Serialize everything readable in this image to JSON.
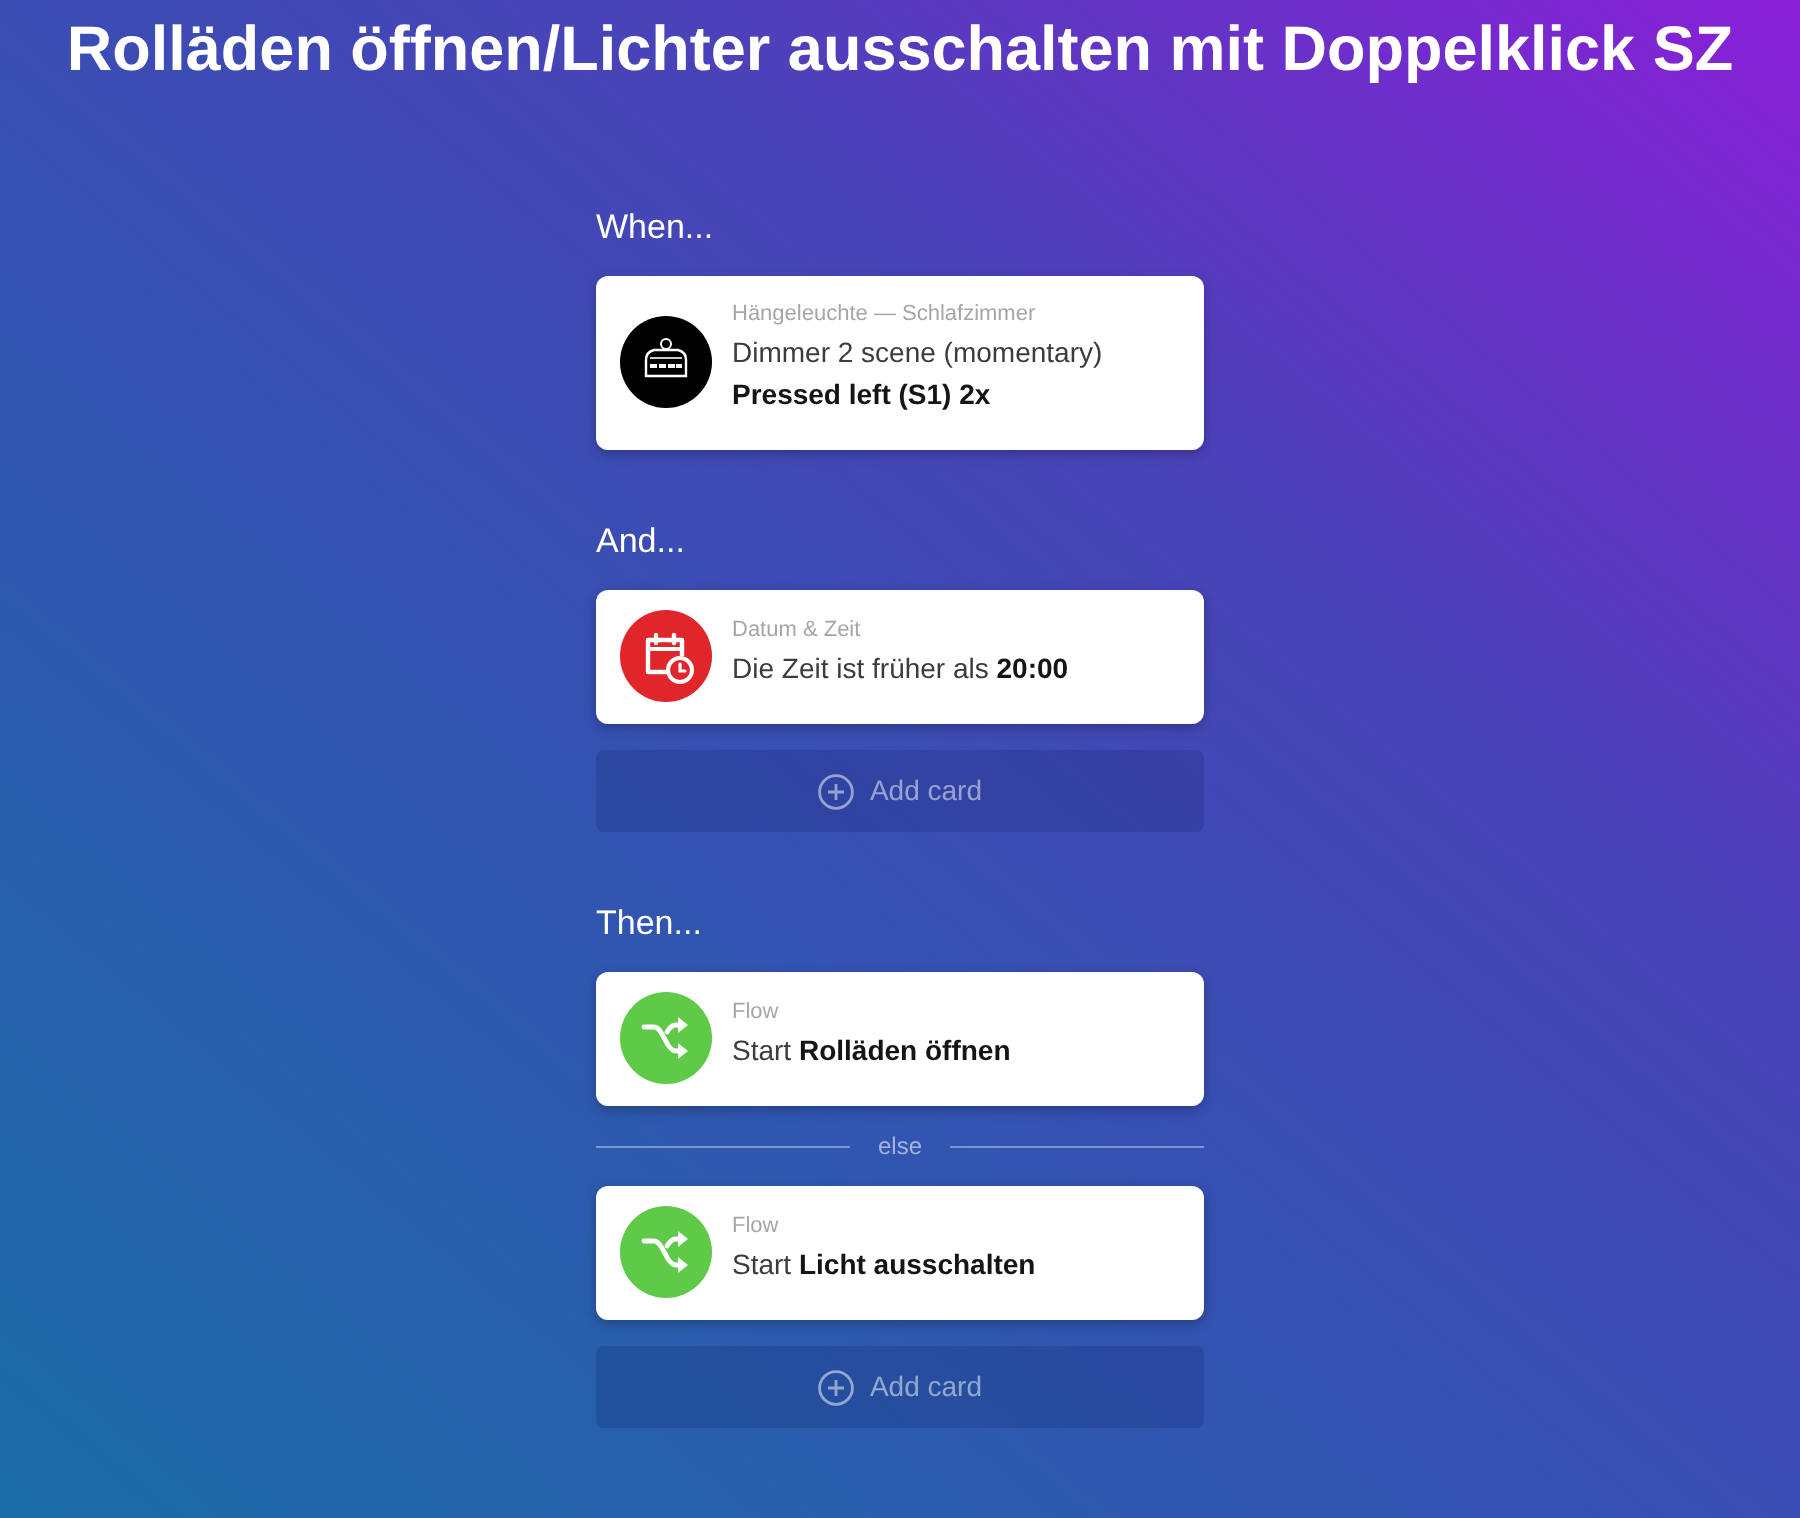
{
  "title": "Rolläden öffnen/Lichter ausschalten mit Doppelklick SZ",
  "sections": [
    {
      "heading": "When...",
      "items": [
        {
          "kind": "device",
          "source": "Hängeleuchte — Schlafzimmer",
          "text": "Dimmer 2 scene (momentary)",
          "detail": "Pressed left (S1) 2x"
        }
      ]
    },
    {
      "heading": "And...",
      "items": [
        {
          "kind": "datetime",
          "source": "Datum & Zeit",
          "text": "Die Zeit ist früher als **20:00**"
        },
        {
          "kind": "add",
          "label": "Add card"
        }
      ]
    },
    {
      "heading": "Then...",
      "items": [
        {
          "kind": "flow",
          "source": "Flow",
          "text": "Start **Rolläden öffnen**"
        },
        {
          "kind": "divider",
          "label": "else"
        },
        {
          "kind": "flow",
          "source": "Flow",
          "text": "Start **Licht ausschalten**"
        },
        {
          "kind": "add",
          "label": "Add card"
        }
      ]
    }
  ]
}
